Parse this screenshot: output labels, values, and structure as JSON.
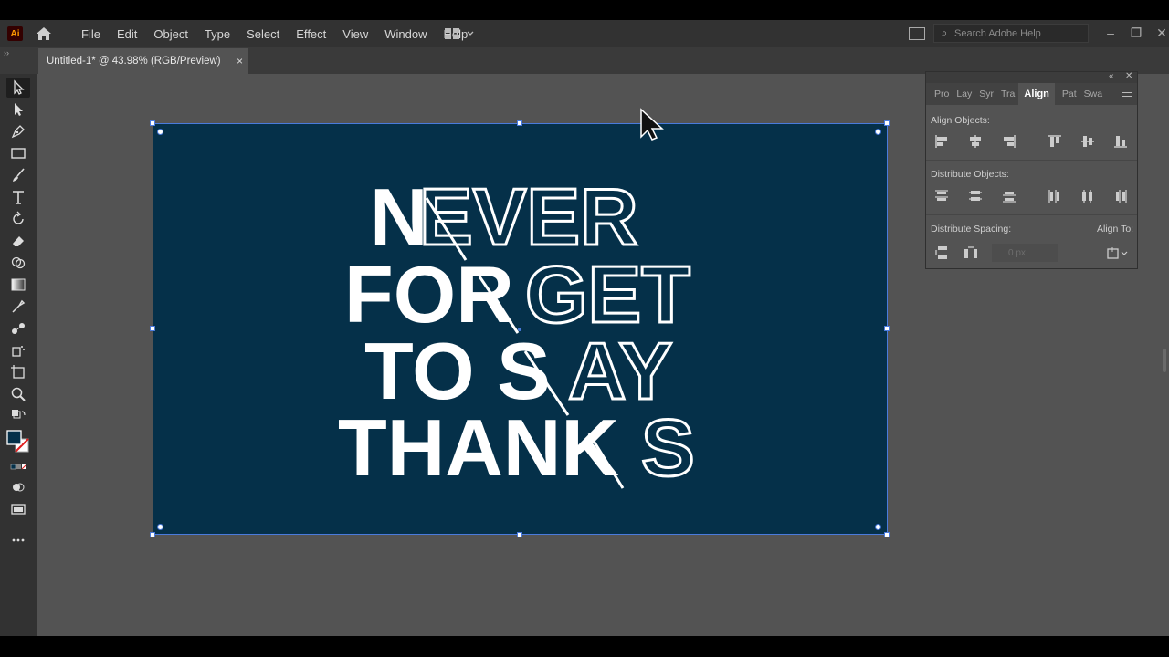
{
  "app": {
    "logo_text": "Ai",
    "accent": "#ff9a00"
  },
  "menu": [
    "File",
    "Edit",
    "Object",
    "Type",
    "Select",
    "Effect",
    "View",
    "Window",
    "Help"
  ],
  "search": {
    "placeholder": "Search Adobe Help"
  },
  "document_tab": {
    "title": "Untitled-1* @ 43.98% (RGB/Preview)",
    "close": "×"
  },
  "artboard": {
    "background": "#053049",
    "lines": [
      "NEVER",
      "FORGET",
      "TO SAY",
      "THANKS"
    ]
  },
  "panel": {
    "tabs": [
      "Pro",
      "Lay",
      "Syr",
      "Tra",
      "Align",
      "Pat",
      "Swa"
    ],
    "active_tab": "Align",
    "align_objects_label": "Align Objects:",
    "distribute_objects_label": "Distribute Objects:",
    "distribute_spacing_label": "Distribute Spacing:",
    "align_to_label": "Align To:",
    "spacing_value": "0 px"
  },
  "colors": {
    "fill": "#053049",
    "stroke": "none"
  }
}
